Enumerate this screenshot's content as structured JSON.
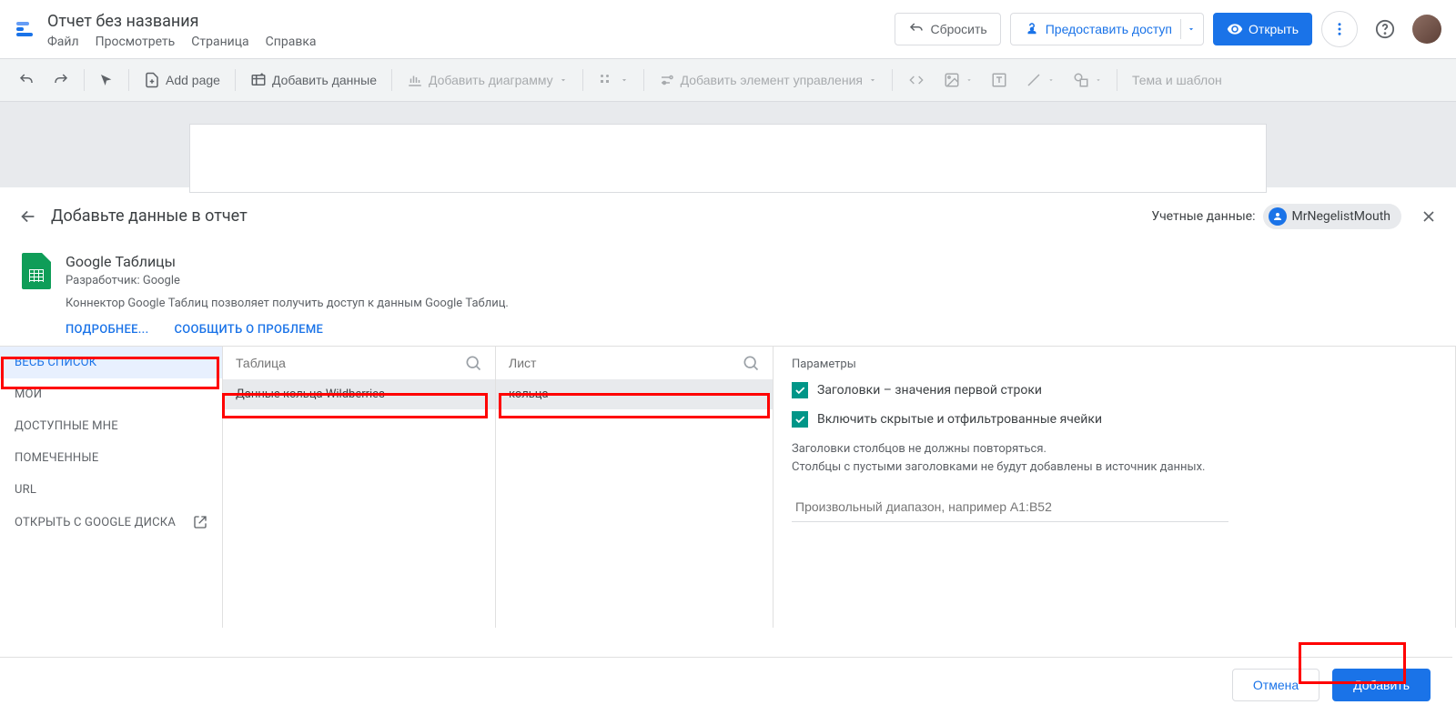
{
  "header": {
    "title": "Отчет без названия",
    "menu": [
      "Файл",
      "Просмотреть",
      "Страница",
      "Справка"
    ],
    "reset": "Сбросить",
    "share": "Предоставить доступ",
    "open": "Открыть"
  },
  "toolbar": {
    "add_page": "Add page",
    "add_data": "Добавить данные",
    "add_chart": "Добавить диаграмму",
    "add_control": "Добавить элемент управления",
    "theme": "Тема и шаблон"
  },
  "panel": {
    "title": "Добавьте данные в отчет",
    "creds_label": "Учетные данные:",
    "creds_user": "MrNegelistMouth"
  },
  "connector": {
    "title": "Google Таблицы",
    "developer": "Разработчик: Google",
    "desc": "Коннектор Google Таблиц позволяет получить доступ к данным Google Таблиц.",
    "more": "ПОДРОБНЕЕ...",
    "report": "СООБЩИТЬ О ПРОБЛЕМЕ"
  },
  "sources": {
    "items": [
      "ВЕСЬ СПИСОК",
      "МОИ",
      "ДОСТУПНЫЕ МНЕ",
      "ПОМЕЧЕННЫЕ",
      "URL",
      "ОТКРЫТЬ С GOOGLE ДИСКА"
    ]
  },
  "tables": {
    "placeholder": "Таблица",
    "selected": "Данные кольца Wildberries"
  },
  "sheets": {
    "placeholder": "Лист",
    "selected": "кольца"
  },
  "params": {
    "label": "Параметры",
    "opt1": "Заголовки – значения первой строки",
    "opt2": "Включить скрытые и отфильтрованные ячейки",
    "note1": "Заголовки столбцов не должны повторяться.",
    "note2": "Столбцы с пустыми заголовками не будут добавлены в источник данных.",
    "range_placeholder": "Произвольный диапазон, например A1:B52"
  },
  "footer": {
    "cancel": "Отмена",
    "add": "Добавить"
  }
}
